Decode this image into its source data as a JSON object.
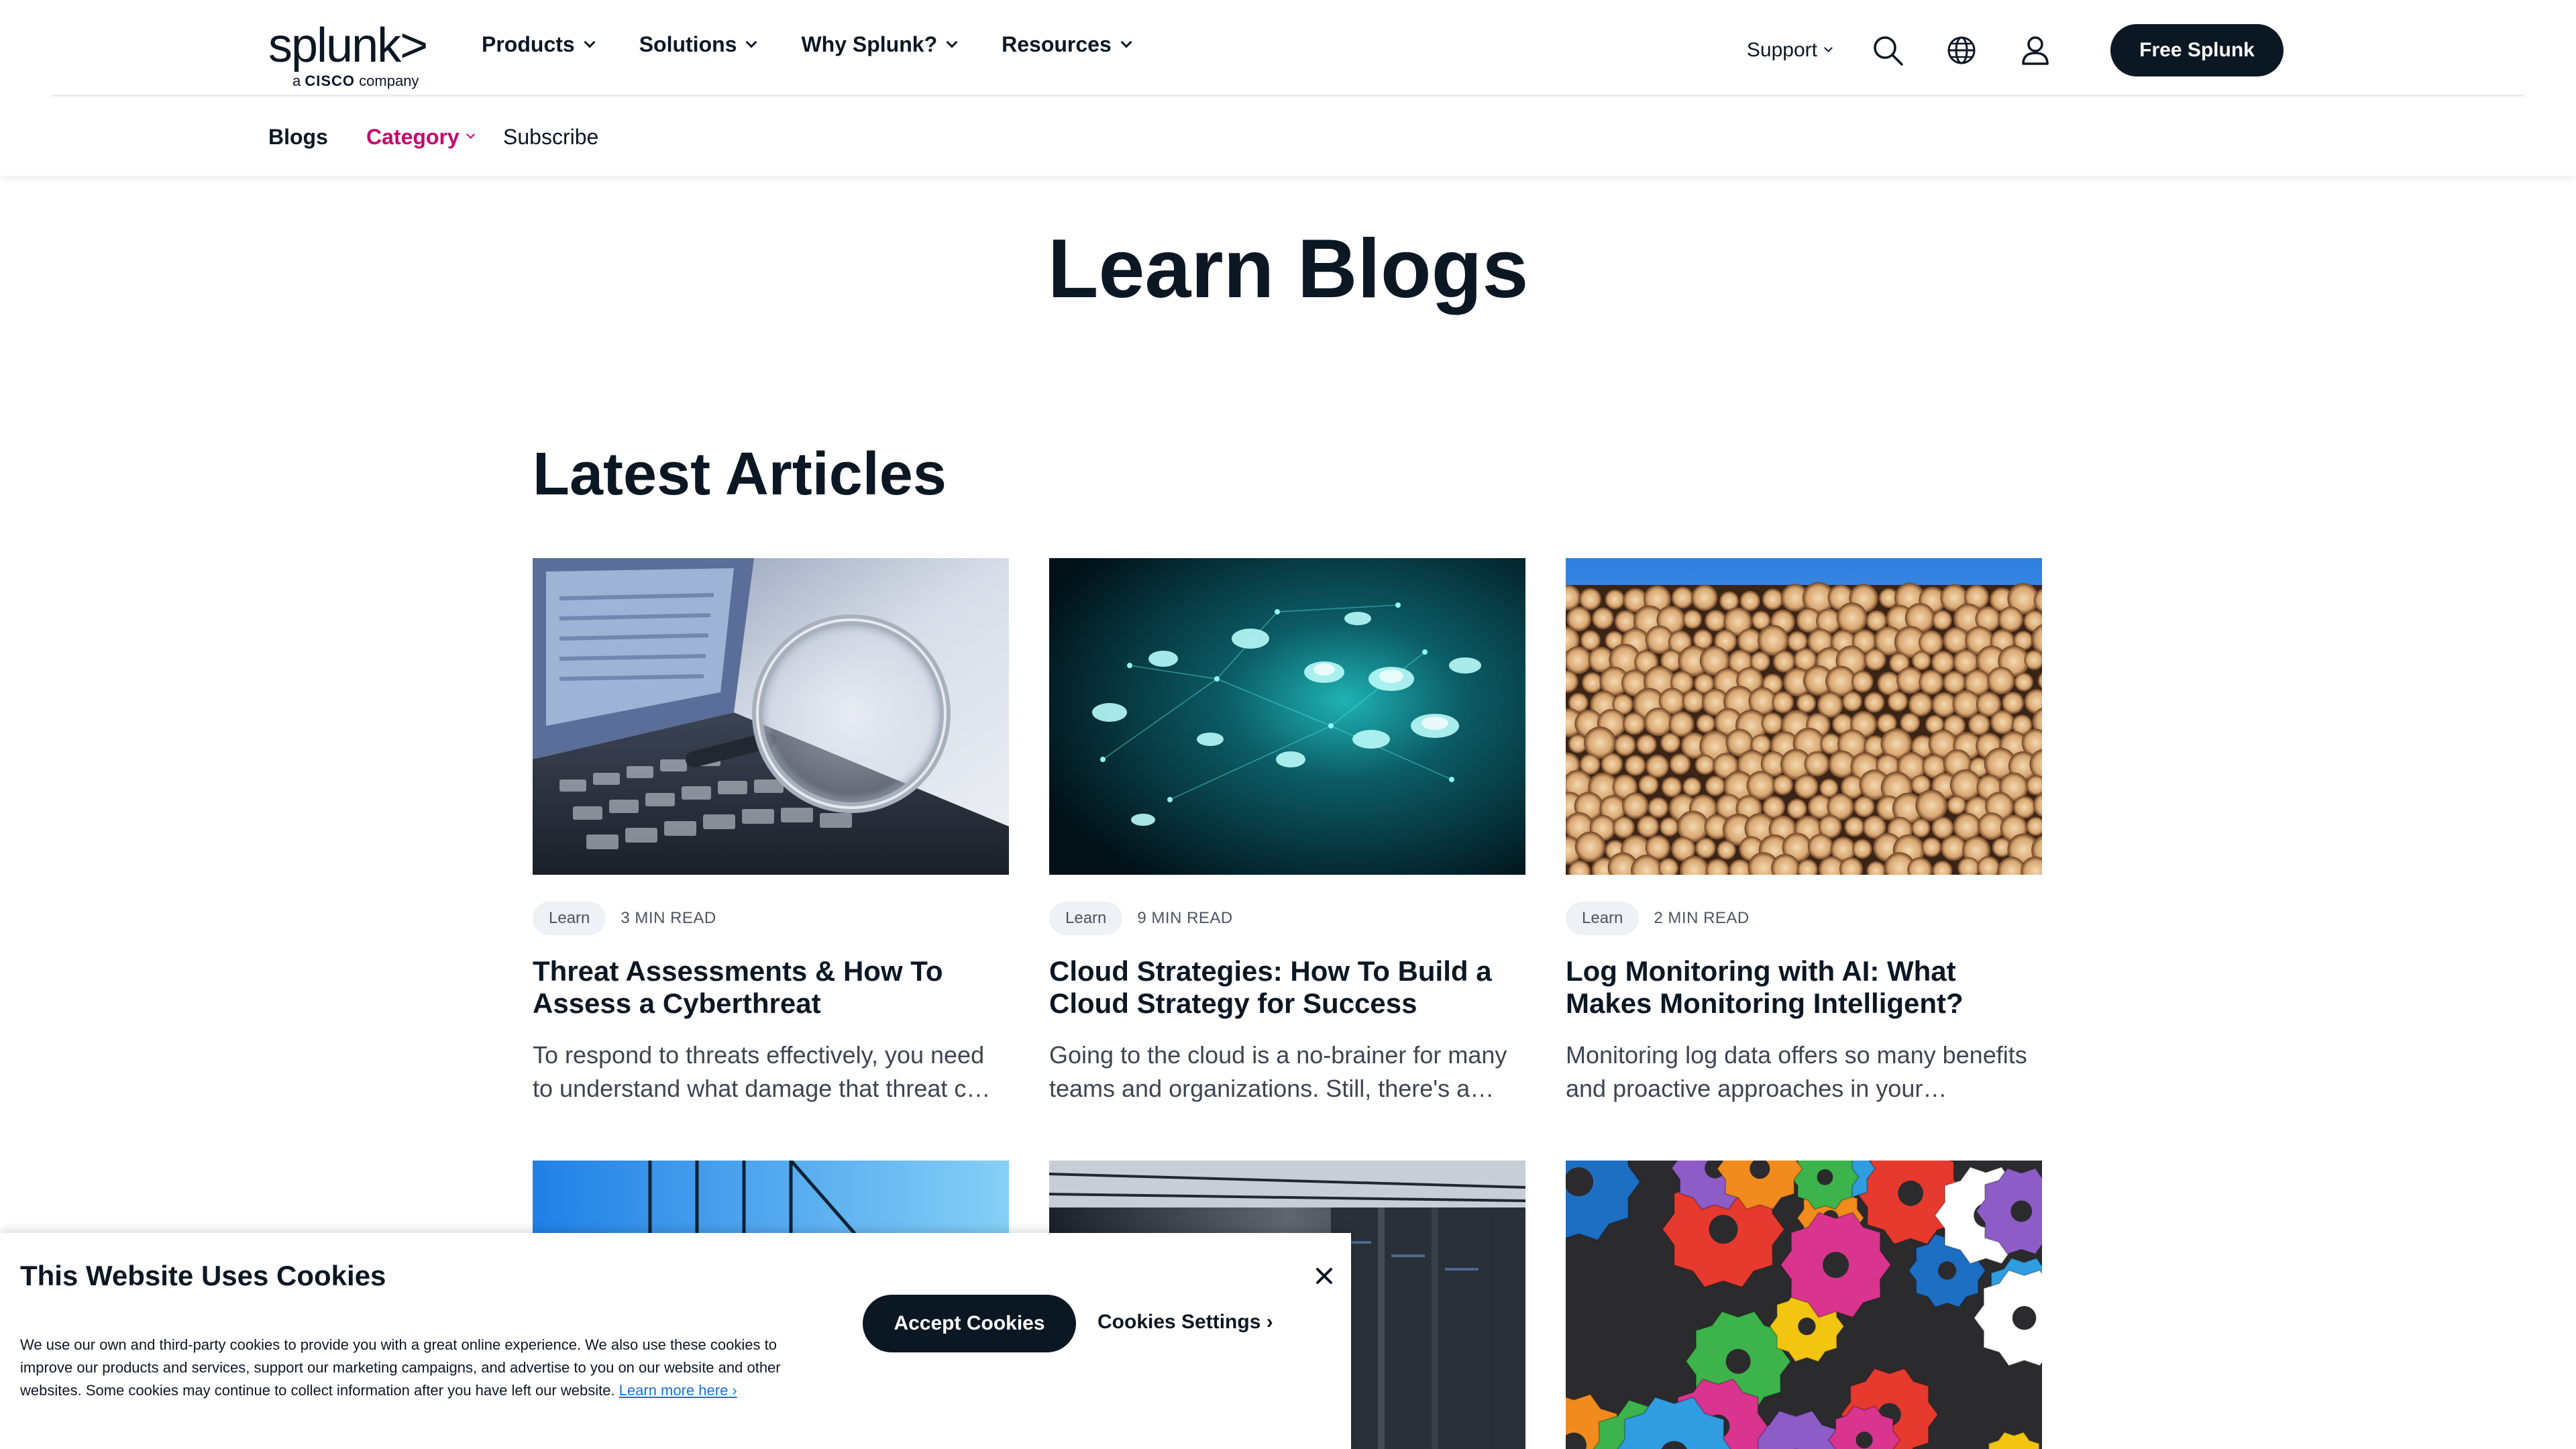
{
  "header": {
    "logo_word": "splunk>",
    "logo_sub_prefix": "a ",
    "logo_sub_cisco": "CISCO",
    "logo_sub_suffix": " company",
    "nav": [
      {
        "label": "Products"
      },
      {
        "label": "Solutions"
      },
      {
        "label": "Why Splunk?"
      },
      {
        "label": "Resources"
      }
    ],
    "support_label": "Support",
    "cta_label": "Free Splunk"
  },
  "subnav": {
    "blogs": "Blogs",
    "category": "Category",
    "subscribe": "Subscribe"
  },
  "page_title": "Learn Blogs",
  "section_title": "Latest Articles",
  "articles": [
    {
      "tag": "Learn",
      "read_time": "3 MIN READ",
      "title": "Threat Assessments & How To Assess a Cyberthreat",
      "excerpt": "To respond to threats effectively, you need to understand what damage that threat c…"
    },
    {
      "tag": "Learn",
      "read_time": "9 MIN READ",
      "title": "Cloud Strategies: How To Build a Cloud Strategy for Success",
      "excerpt": "Going to the cloud is a no-brainer for many teams and organizations. Still, there's a…"
    },
    {
      "tag": "Learn",
      "read_time": "2 MIN READ",
      "title": "Log Monitoring with AI: What Makes Monitoring Intelligent?",
      "excerpt": "Monitoring log data offers so many benefits and proactive approaches in your…"
    }
  ],
  "cookie": {
    "title": "This Website Uses Cookies",
    "body": "We use our own and third-party cookies to provide you with a great online experience. We also use these cookies to improve our products and services, support our marketing campaigns, and advertise to you on our website and other websites. Some cookies may continue to collect information after you have left our website. ",
    "learn_more": "Learn more here ›",
    "accept": "Accept Cookies",
    "settings": "Cookies Settings ›"
  },
  "colors": {
    "navy": "#0c1724",
    "accent_pink": "#c8046e",
    "link_blue": "#1a6fd6"
  },
  "icons": [
    "search-icon",
    "globe-icon",
    "user-icon",
    "close-icon"
  ]
}
